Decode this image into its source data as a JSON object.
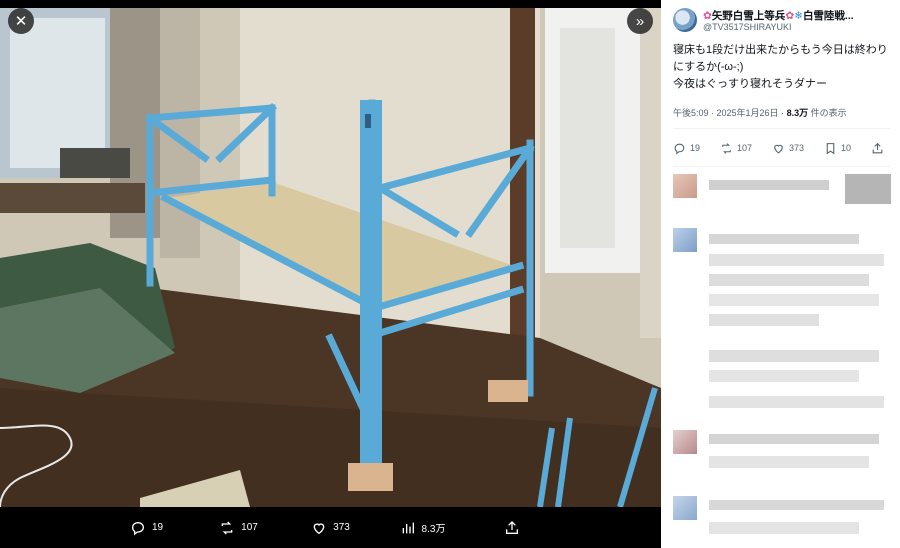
{
  "viewer": {
    "close_icon": "close-icon",
    "expand_icon": "expand-icon",
    "actions": [
      {
        "icon": "reply-icon",
        "count": "19"
      },
      {
        "icon": "retweet-icon",
        "count": "107"
      },
      {
        "icon": "like-icon",
        "count": "373"
      },
      {
        "icon": "views-icon",
        "count": "8.3万"
      },
      {
        "icon": "share-icon",
        "count": ""
      }
    ]
  },
  "tweet": {
    "display_name": "矢野白雪上等兵",
    "name_extra": "白雪陸戦...",
    "handle": "@TV3517SHIRAYUKI",
    "text_line1": "寝床も1段だけ出来たからもう今日は終わりにするか(-ω-;)",
    "text_line2": "今夜はぐっすり寝れそうダナー",
    "time": "午後5:09 · 2025年1月26日 · ",
    "views": "8.3万",
    "views_suffix": " 件の表示",
    "stats": {
      "replies": "19",
      "retweets": "107",
      "likes": "373",
      "bookmarks": "10"
    }
  },
  "colors": {
    "accent": "#1d9bf0",
    "text_secondary": "#536471",
    "bed_frame": "#5aaad8",
    "plywood": "#d8c9a0"
  }
}
